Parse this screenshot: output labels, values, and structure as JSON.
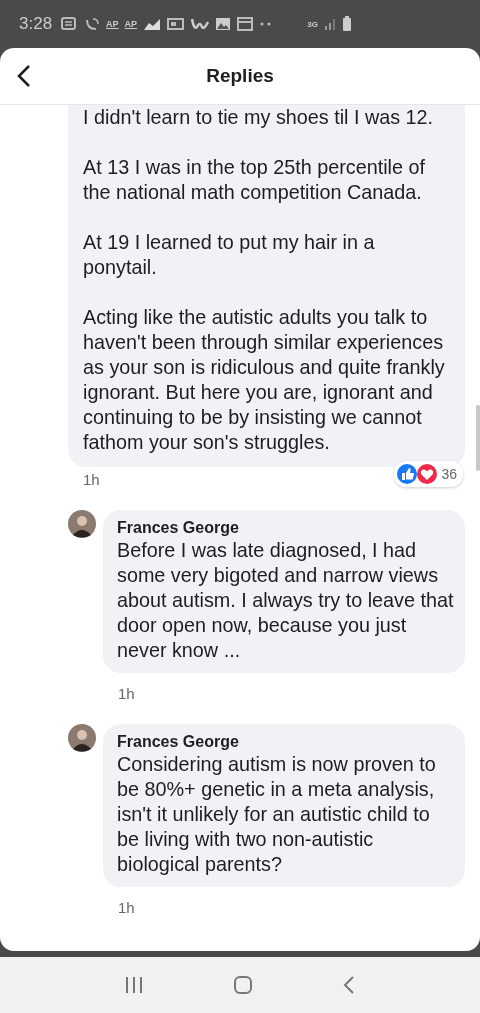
{
  "status_bar": {
    "time": "3:28",
    "icon_labels": [
      "AP",
      "AP"
    ],
    "network": "3G"
  },
  "header": {
    "title": "Replies"
  },
  "parent_comment": {
    "paragraphs": [
      "I didn't learn to tie my shoes til I was 12.",
      "At 13 I was in the top 25th percentile of the national math competition Canada.",
      "At 19 I learned to put my hair in a ponytail.",
      "Acting like the autistic adults you talk to haven't been through similar experiences as your son is ridiculous and quite frankly ignorant. But here you are, ignorant and continuing to be by insisting we cannot fathom your son's struggles."
    ],
    "time": "1h",
    "reaction_count": "36"
  },
  "replies": [
    {
      "author": "Frances George",
      "text": "Before I was late diagnosed, I had some very bigoted and narrow views about autism. I always try to leave that door open now, because you just never know ...",
      "time": "1h"
    },
    {
      "author": "Frances George",
      "text": "Considering autism is now proven to be 80%+ genetic in a meta analysis, isn't it unlikely for an autistic child to be living with two non-autistic biological parents?",
      "time": "1h"
    }
  ]
}
